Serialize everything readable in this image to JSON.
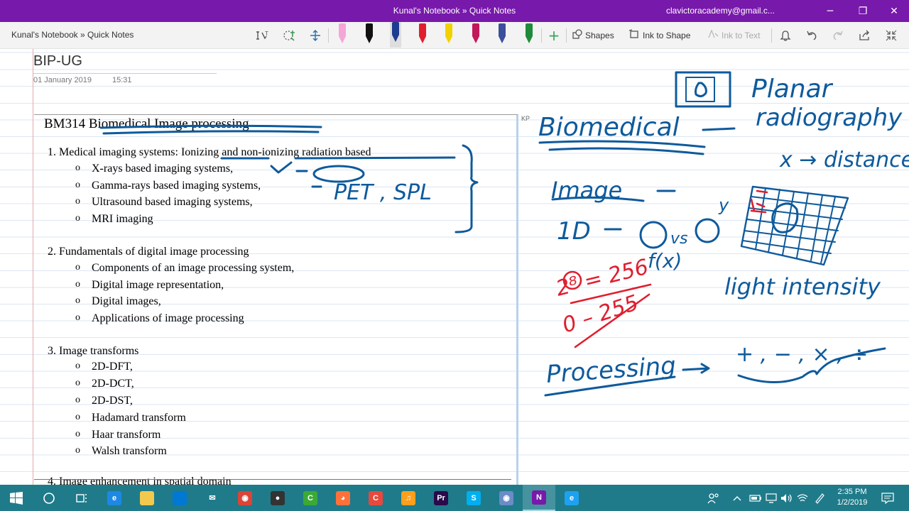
{
  "window": {
    "title": "Kunal's Notebook » Quick Notes",
    "account": "clavictoracademy@gmail.c...",
    "minimize_glyph": "─",
    "restore_glyph": "❐",
    "close_glyph": "✕"
  },
  "toolbar": {
    "breadcrumb": "Kunal's Notebook » Quick Notes",
    "shapes_label": "Shapes",
    "ink_to_shape_label": "Ink to Shape",
    "ink_to_text_label": "Ink to Text",
    "pen_colors": [
      "#f4a6d7",
      "#111111",
      "#1d3b8f",
      "#e01e2e",
      "#f2d100",
      "#c2185b",
      "#3d4e9c",
      "#1f8a3a"
    ]
  },
  "page": {
    "title": "BIP-UG",
    "date": "01 January 2019",
    "time": "15:31",
    "kp_tag": "KP"
  },
  "document": {
    "heading": "BM314 Biomedical Image processing",
    "sections": [
      {
        "title": "1.   Medical imaging systems: Ionizing and non-ionizing radiation based",
        "items": [
          "X-rays based imaging systems,",
          "Gamma-rays based imaging systems,",
          "Ultrasound based imaging systems,",
          "MRI imaging"
        ]
      },
      {
        "title": "2.   Fundamentals of digital image processing",
        "items": [
          "Components of an image processing system,",
          "Digital image representation,",
          "Digital images,",
          "Applications of image processing"
        ]
      },
      {
        "title": "3.   Image transforms",
        "items": [
          "2D-DFT,",
          "2D-DCT,",
          "2D-DST,",
          "Hadamard transform",
          "Haar transform",
          "Walsh transform"
        ]
      }
    ],
    "cutoff_line": "4.   Image enhancement in spatial domain"
  },
  "ink_notes": {
    "pet_spl": "PET , SPL",
    "planar_1": "Planar",
    "planar_2": "radiography",
    "biomedical": "Biomedical",
    "x_distance": "x → distance",
    "image": "Image",
    "one_d": "1D",
    "vs": "vs",
    "f_of_x": "f(x)",
    "y_label": "y",
    "light_intensity": "light intensity",
    "two_eight": "2⁸ = 256",
    "zero_255": "0 – 255",
    "processing": "Processing",
    "operators": "+ , − , × , ÷"
  },
  "taskbar": {
    "apps": [
      {
        "name": "edge",
        "color": "#1e88e5",
        "glyph": "e"
      },
      {
        "name": "file-explorer",
        "color": "#f2c94c",
        "glyph": ""
      },
      {
        "name": "store",
        "color": "#0078d4",
        "glyph": ""
      },
      {
        "name": "mail",
        "color": "#1f7b8a",
        "glyph": "✉"
      },
      {
        "name": "chrome",
        "color": "#db4437",
        "glyph": "◉"
      },
      {
        "name": "media",
        "color": "#333333",
        "glyph": "●"
      },
      {
        "name": "camtasia",
        "color": "#3aaa35",
        "glyph": "C"
      },
      {
        "name": "firefox",
        "color": "#ff7139",
        "glyph": "◕"
      },
      {
        "name": "camtasia-recorder",
        "color": "#e8483d",
        "glyph": "C"
      },
      {
        "name": "audio",
        "color": "#ff9f1c",
        "glyph": "♫"
      },
      {
        "name": "premiere",
        "color": "#2a0a4a",
        "glyph": "Pr"
      },
      {
        "name": "skype",
        "color": "#00aff0",
        "glyph": "S"
      },
      {
        "name": "chrome-2",
        "color": "#6a8cc7",
        "glyph": "◉"
      },
      {
        "name": "onenote",
        "color": "#7719aa",
        "glyph": "N"
      },
      {
        "name": "internet-explorer",
        "color": "#1ea1f1",
        "glyph": "e"
      }
    ],
    "time": "2:35 PM",
    "date": "1/2/2019"
  }
}
